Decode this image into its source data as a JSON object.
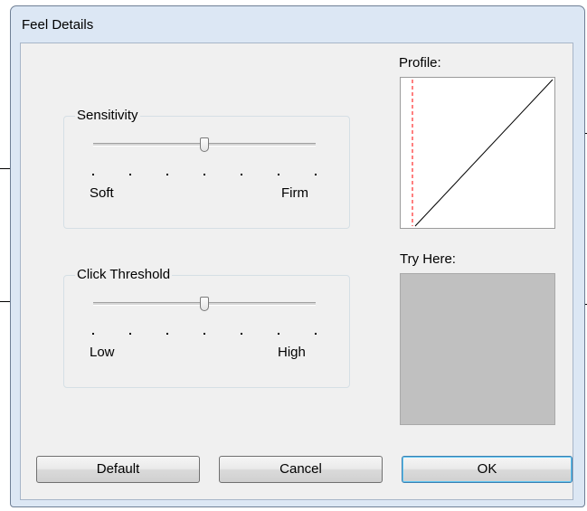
{
  "window": {
    "title": "Feel Details"
  },
  "sensitivity": {
    "group_label": "Sensitivity",
    "min_label": "Soft",
    "max_label": "Firm",
    "value_fraction": 0.5,
    "tick_count": 7
  },
  "click_threshold": {
    "group_label": "Click Threshold",
    "min_label": "Low",
    "max_label": "High",
    "value_fraction": 0.5,
    "tick_count": 7
  },
  "profile": {
    "label": "Profile:"
  },
  "try_here": {
    "label": "Try Here:"
  },
  "buttons": {
    "default_label": "Default",
    "cancel_label": "Cancel",
    "ok_label": "OK"
  },
  "colors": {
    "window_frame": "#dce7f4",
    "client_bg": "#f0f0f0",
    "try_area": "#c0c0c0",
    "profile_marker": "#ff0000"
  }
}
